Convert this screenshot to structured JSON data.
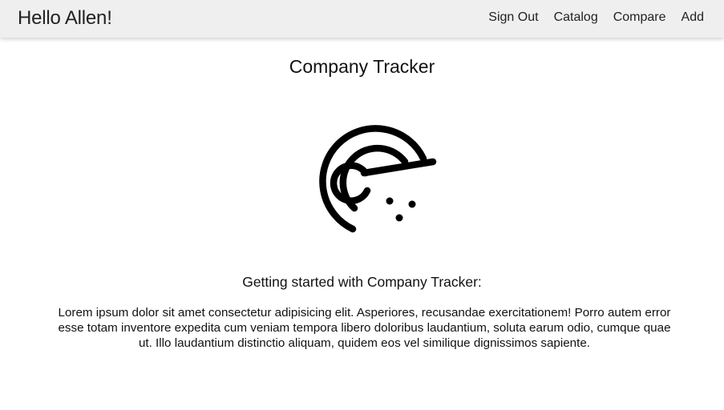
{
  "navbar": {
    "brand": "Hello Allen!",
    "links": [
      {
        "label": "Sign Out"
      },
      {
        "label": "Catalog"
      },
      {
        "label": "Compare"
      },
      {
        "label": "Add"
      }
    ]
  },
  "main": {
    "title": "Company Tracker",
    "logo_icon": "radar-icon",
    "getting_started_heading": "Getting started with Company Tracker:",
    "description": "Lorem ipsum dolor sit amet consectetur adipisicing elit. Asperiores, recusandae exercitationem! Porro autem error esse totam inventore expedita cum veniam tempora libero doloribus laudantium, soluta earum odio, cumque quae ut. Illo laudantium distinctio aliquam, quidem eos vel similique dignissimos sapiente."
  },
  "colors": {
    "navbar_background": "#efefef",
    "text": "#111111",
    "icon": "#000000"
  }
}
